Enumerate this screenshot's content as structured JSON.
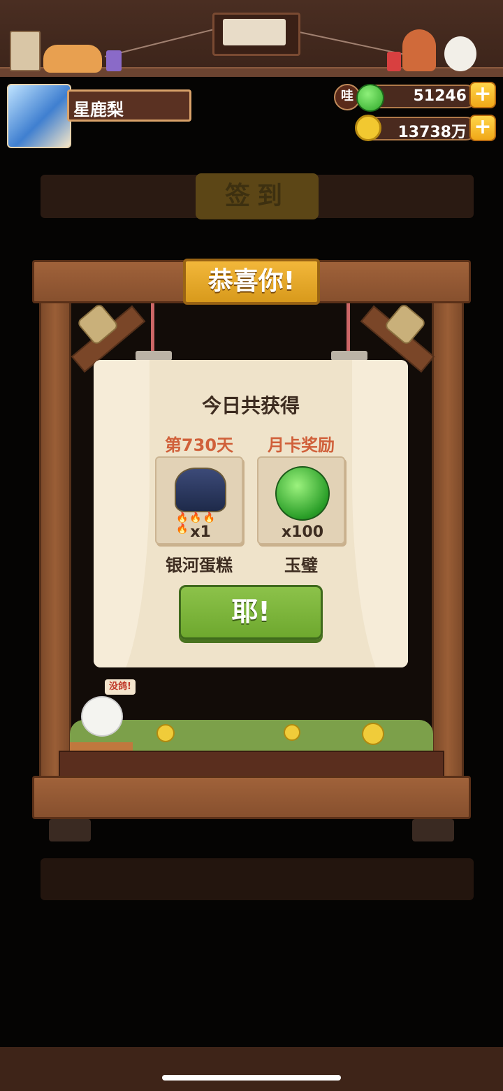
{
  "header": {
    "player_name": "星鹿梨",
    "currencies": [
      {
        "name": "jade",
        "icon": "jade-disc-icon",
        "badge": "哇",
        "value": "51246"
      },
      {
        "name": "coins",
        "icon": "coin-icon",
        "value": "13738万"
      }
    ],
    "plus_symbol": "+"
  },
  "background": {
    "panel_title": "签到"
  },
  "popup": {
    "banner": "恭喜你!",
    "title": "今日共获得",
    "rewards": [
      {
        "label": "第730天",
        "icon": "galaxy-cake-icon",
        "qty": "x1",
        "name": "银河蛋糕"
      },
      {
        "label": "月卡奖励",
        "icon": "jade-disc-icon",
        "qty": "x100",
        "name": "玉璧"
      }
    ],
    "confirm_button": "耶!"
  },
  "mascot": {
    "speech": "没鸽!"
  },
  "colors": {
    "accent_orange": "#d0603a",
    "button_green": "#7ab43a",
    "gold": "#f0b428",
    "wood": "#9a5e36"
  }
}
